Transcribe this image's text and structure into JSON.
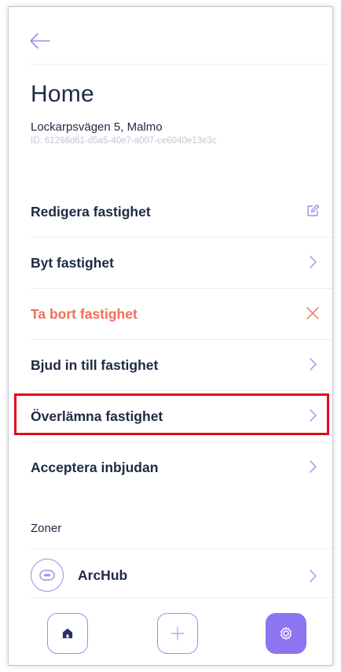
{
  "header": {
    "back_icon": "arrow-left-icon"
  },
  "property": {
    "title": "Home",
    "address": "Lockarpsvägen 5, Malmo",
    "id_text": "ID: 61268d61-d5a5-40e7-a007-ce6040e13e3c"
  },
  "menu": {
    "items": [
      {
        "label": "Redigera fastighet",
        "icon": "edit-icon"
      },
      {
        "label": "Byt fastighet",
        "icon": "chevron-right-icon"
      },
      {
        "label": "Ta bort fastighet",
        "icon": "close-icon",
        "danger": true
      },
      {
        "label": "Bjud in till fastighet",
        "icon": "chevron-right-icon"
      },
      {
        "label": "Överlämna fastighet",
        "icon": "chevron-right-icon"
      },
      {
        "label": "Acceptera inbjudan",
        "icon": "chevron-right-icon"
      }
    ]
  },
  "zones": {
    "heading": "Zoner",
    "items": [
      {
        "name": "ArcHub",
        "icon": "hub-device-icon"
      }
    ]
  },
  "bottom_nav": {
    "home_icon": "home-icon",
    "add_icon": "plus-icon",
    "settings_icon": "gear-icon"
  },
  "colors": {
    "accent": "#8d74f0",
    "accent_light": "#9d8ef0",
    "text_primary": "#1e2a44",
    "text_muted": "#c3c5d1",
    "danger": "#ef6f55",
    "highlight_border": "#e00b1c"
  }
}
